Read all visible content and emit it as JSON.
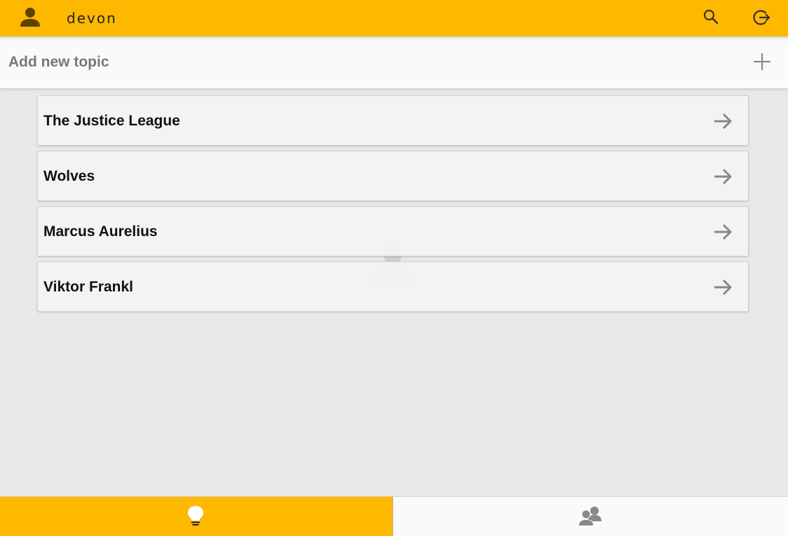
{
  "header": {
    "username": "devon",
    "icons": {
      "avatar": "person-icon",
      "search": "search-icon",
      "logout": "logout-icon"
    }
  },
  "add_topic": {
    "placeholder": "Add new topic",
    "value": "",
    "icon": "plus-icon"
  },
  "topics": [
    {
      "label": "The Justice League",
      "icon": "arrow-right-icon"
    },
    {
      "label": "Wolves",
      "icon": "arrow-right-icon"
    },
    {
      "label": "Marcus Aurelius",
      "icon": "arrow-right-icon"
    },
    {
      "label": "Viktor Frankl",
      "icon": "arrow-right-icon"
    }
  ],
  "bottom_nav": {
    "tabs": [
      {
        "name": "topics",
        "icon": "lightbulb-icon",
        "active": true
      },
      {
        "name": "people",
        "icon": "people-icon",
        "active": false
      }
    ]
  },
  "colors": {
    "accent": "#ffb800",
    "background": "#e8e8e8",
    "card": "#f4f4f4",
    "icon_grey": "#888888"
  }
}
